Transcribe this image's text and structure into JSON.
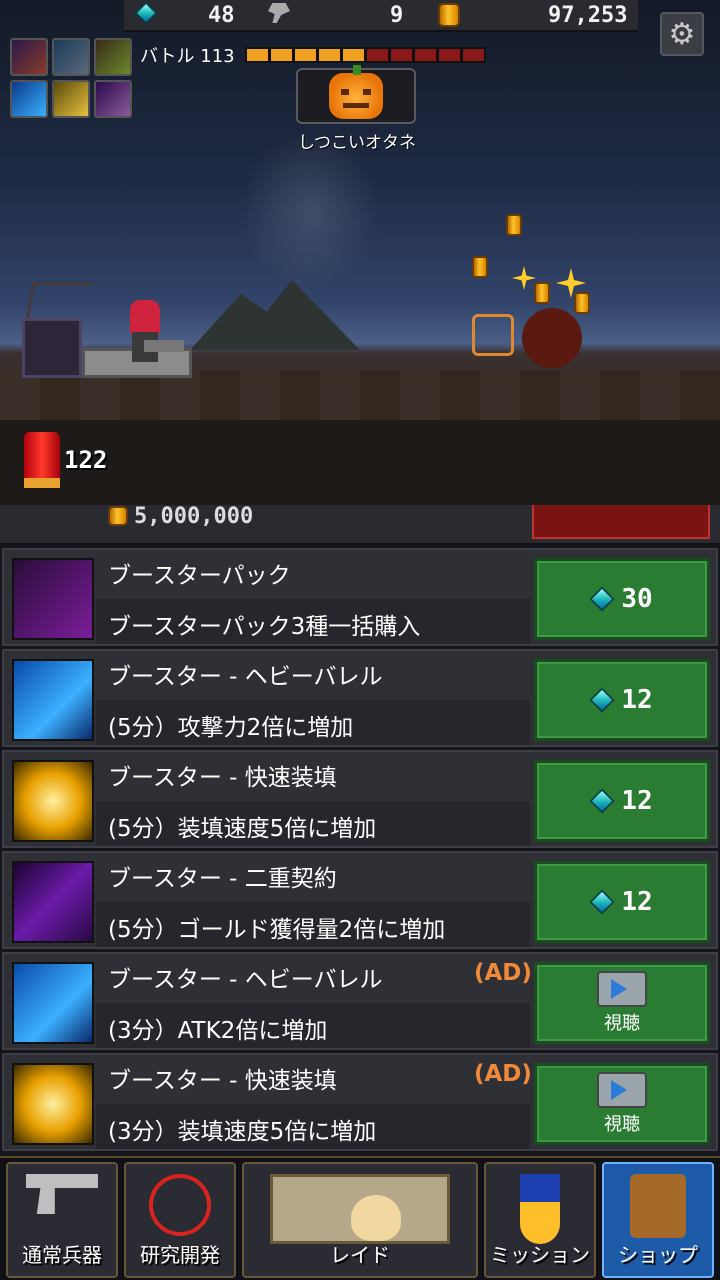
{
  "currency": {
    "gems": "48",
    "parts": "9",
    "gold": "97,253"
  },
  "battle": {
    "label": "バトル 113",
    "hp_filled": 5,
    "hp_total": 10
  },
  "boss": {
    "name": "しつこいオタネ"
  },
  "ammo": {
    "count": "122"
  },
  "partial_item": {
    "price": "5,000,000"
  },
  "shop_items": [
    {
      "title": "ブースターパック",
      "desc": "ブースターパック3種一括購入",
      "price": "30",
      "icon": "booster-pack-icon",
      "ad": ""
    },
    {
      "title": "ブースター - ヘビーバレル",
      "desc": "(5分）攻撃力2倍に増加",
      "price": "12",
      "icon": "heavy-barrel-icon",
      "ad": ""
    },
    {
      "title": "ブースター - 快速装填",
      "desc": "(5分）装填速度5倍に増加",
      "price": "12",
      "icon": "fast-reload-icon",
      "ad": ""
    },
    {
      "title": "ブースター - 二重契約",
      "desc": "(5分）ゴールド獲得量2倍に増加",
      "price": "12",
      "icon": "double-contract-icon",
      "ad": ""
    },
    {
      "title": "ブースター - ヘビーバレル",
      "desc": "(3分）ATK2倍に増加",
      "ad": "(AD)",
      "watch": "視聴",
      "icon": "heavy-barrel-icon"
    },
    {
      "title": "ブースター - 快速装填",
      "desc": "(3分）装填速度5倍に増加",
      "ad": "(AD)",
      "watch": "視聴",
      "icon": "fast-reload-icon"
    }
  ],
  "nav": [
    {
      "label": "通常兵器",
      "icon": "pistol-icon"
    },
    {
      "label": "研究開発",
      "icon": "crosshair-icon"
    },
    {
      "label": "レイド",
      "icon": "skull-map-icon"
    },
    {
      "label": "ミッション",
      "icon": "medal-icon"
    },
    {
      "label": "ショップ",
      "icon": "shopping-bag-icon",
      "active": true
    }
  ],
  "colors": {
    "buy_button": "#2a7c32",
    "ad_label": "#f08a3a",
    "hp_filled": "#f0a020",
    "hp_empty": "#8a1a1a",
    "nav_active": "#1d5aa8"
  }
}
